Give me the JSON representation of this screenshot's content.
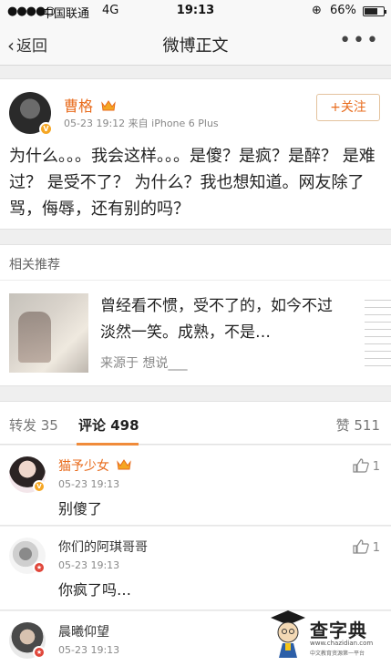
{
  "status_bar": {
    "signal": "●●●●○",
    "carrier": "中国联通",
    "network": "4G",
    "time": "19:13",
    "battery": "66%"
  },
  "nav": {
    "back_label": "返回",
    "title": "微博正文",
    "more": "•••"
  },
  "post": {
    "author": "曹格",
    "meta": "05-23 19:12  来自 iPhone 6 Plus",
    "follow_label": "+关注",
    "text": "为什么。。。我会这样。。。是傻？是疯？是醉？ 是难过？ 是受不了？ 为什么？我也想知道。网友除了骂，侮辱，还有别的吗？"
  },
  "related": {
    "header": "相关推荐",
    "text": "曾经看不惯，受不了的，如今不过淡然一笑。成熟，不是…",
    "source": "来源于 想说___"
  },
  "tabs": {
    "repost": "转发 35",
    "comment": "评论 498",
    "like": "赞 511"
  },
  "comments": [
    {
      "name": "猫予少女",
      "time": "05-23 19:13",
      "text": "别傻了",
      "likes": "1"
    },
    {
      "name": "你们的阿琪哥哥",
      "time": "05-23 19:13",
      "text": "你疯了吗…",
      "likes": "1"
    },
    {
      "name": "晨曦仰望",
      "time": "05-23 19:13"
    }
  ],
  "watermark": {
    "title": "查字典",
    "url": "www.chazidian.com",
    "sub": "中文教育资源第一平台"
  },
  "colors": {
    "accent": "#e86b1c",
    "background": "#efefef",
    "tab_underline": "#f08b3a"
  }
}
